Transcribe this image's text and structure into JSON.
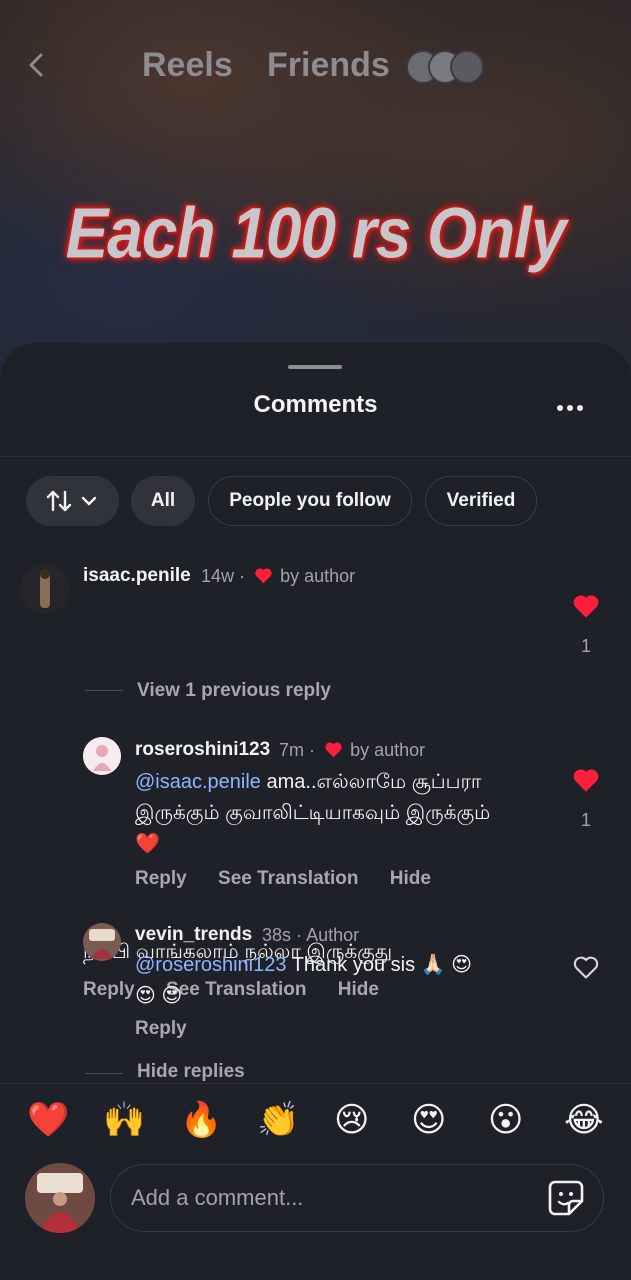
{
  "header": {
    "tabs": [
      "Reels",
      "Friends"
    ],
    "overlay_text": "Each 100 rs Only"
  },
  "sheet": {
    "title": "Comments",
    "filters": {
      "all": "All",
      "people_you_follow": "People you follow",
      "verified": "Verified"
    }
  },
  "comments": [
    {
      "username": "isaac.penile",
      "time": "14w",
      "author_badge": "by author",
      "text": "நம்பி வாங்கலாம் நல்லா இருக்குது",
      "actions": {
        "reply": "Reply",
        "translate": "See Translation",
        "hide": "Hide"
      },
      "likes": "1",
      "liked": true,
      "view_previous": "View 1 previous reply"
    },
    {
      "username": "roseroshini123",
      "time": "7m",
      "author_badge": "by author",
      "mention": "@isaac.penile",
      "text_line1": " ama..எல்லாமே சூப்பரா",
      "text_line2": "இருக்கும் குவாலிட்டியாகவும் இருக்கும்",
      "text_line3": "❤️",
      "actions": {
        "reply": "Reply",
        "translate": "See Translation",
        "hide": "Hide"
      },
      "likes": "1",
      "liked": true
    },
    {
      "username": "vevin_trends",
      "time": "38s",
      "author_label": "Author",
      "mention": "@roseroshini123",
      "text_line1": " Thank you  sis 🙏🏻 😍",
      "text_line2": "😍 😍",
      "actions": {
        "reply": "Reply"
      },
      "liked": false,
      "hide_replies": "Hide replies"
    }
  ],
  "emoji_bar": [
    "❤️",
    "🙌",
    "🔥",
    "👏",
    "😢",
    "😍",
    "😮",
    "😂"
  ],
  "composer": {
    "placeholder": "Add a comment..."
  },
  "colors": {
    "background": "#1f2128",
    "like_red": "#ff1f3a",
    "mention_blue": "#8fb4ff",
    "muted_text": "#a2a3a8"
  }
}
